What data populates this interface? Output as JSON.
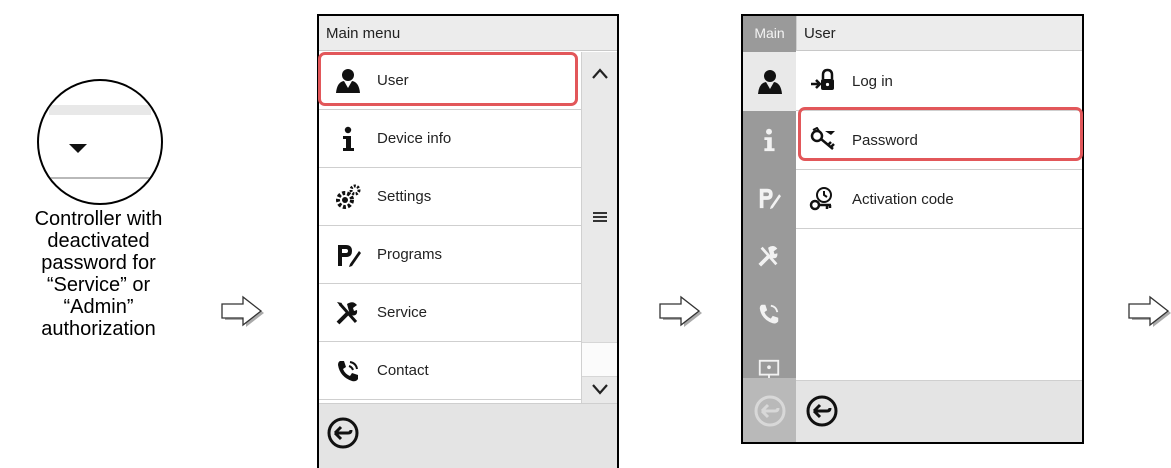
{
  "panel1": {
    "caption_lines": [
      "Controller with",
      "deactivated",
      "password for",
      "“Service” or",
      "“Admin”",
      "authorization"
    ]
  },
  "screen1": {
    "header": "Main menu",
    "items": [
      {
        "label": "User",
        "icon": "user-icon"
      },
      {
        "label": "Device info",
        "icon": "info-icon"
      },
      {
        "label": "Settings",
        "icon": "gears-icon"
      },
      {
        "label": "Programs",
        "icon": "programs-icon"
      },
      {
        "label": "Service",
        "icon": "service-tools-icon"
      },
      {
        "label": "Contact",
        "icon": "phone-icon"
      }
    ],
    "highlighted": "User"
  },
  "screen2": {
    "sidebar_title": "Main",
    "header": "User",
    "items": [
      {
        "label": "Log in",
        "icon": "login-lock-icon"
      },
      {
        "label": "Password",
        "icon": "password-key-icon"
      },
      {
        "label": "Activation code",
        "icon": "activation-code-icon"
      }
    ],
    "highlighted": "Password"
  },
  "colors": {
    "highlight": "#e2575a",
    "sidebar": "#9a9a9a",
    "header_bg": "#ececec"
  }
}
